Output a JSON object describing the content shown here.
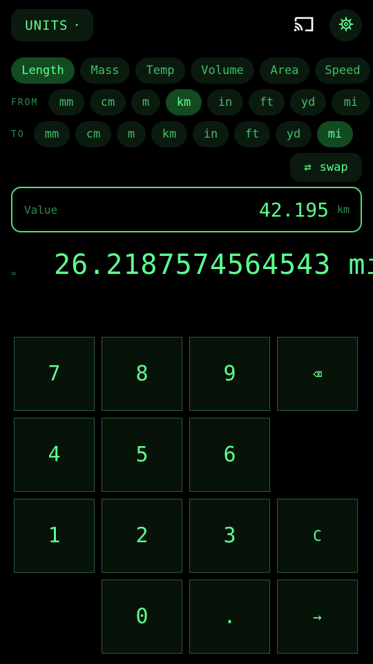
{
  "top_bar": {
    "units_label": "UNITS",
    "caret": "▾"
  },
  "categories": [
    "Length",
    "Mass",
    "Temp",
    "Volume",
    "Area",
    "Speed"
  ],
  "active_category": "Length",
  "from": {
    "label": "FROM",
    "units": [
      "mm",
      "cm",
      "m",
      "km",
      "in",
      "ft",
      "yd",
      "mi"
    ],
    "selected": "km"
  },
  "to": {
    "label": "TO",
    "units": [
      "mm",
      "cm",
      "m",
      "km",
      "in",
      "ft",
      "yd",
      "mi"
    ],
    "selected": "mi"
  },
  "swap": {
    "icon": "⇄",
    "label": "swap"
  },
  "input": {
    "label": "Value",
    "value": "42.195",
    "unit": "km"
  },
  "result": {
    "equals": "=",
    "value": "26.2187574564543 mi"
  },
  "keypad": {
    "seven": "7",
    "eight": "8",
    "nine": "9",
    "backspace": "⌫",
    "four": "4",
    "five": "5",
    "six": "6",
    "one": "1",
    "two": "2",
    "three": "3",
    "clear": "C",
    "zero": "0",
    "dot": ".",
    "enter": "→"
  },
  "colors": {
    "background": "#000000",
    "accent": "#5dff8f",
    "chip_bg": "#0b1a0e",
    "chip_active": "#124a22"
  }
}
